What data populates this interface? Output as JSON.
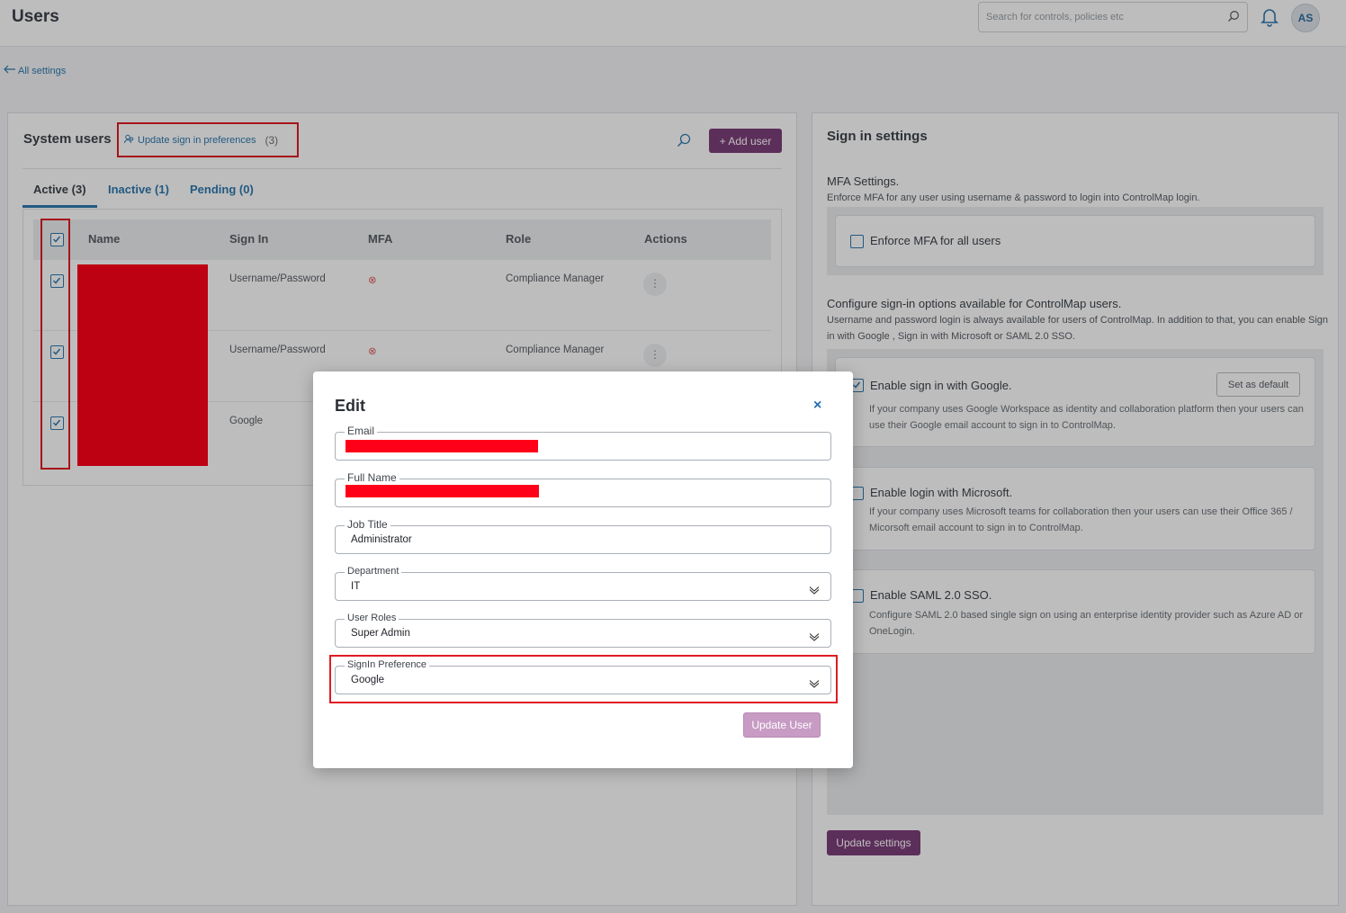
{
  "page": {
    "title": "Users"
  },
  "header": {
    "search_placeholder": "Search for controls, policies etc",
    "avatar_initials": "AS"
  },
  "back_link": "All settings",
  "system_users": {
    "title": "System users",
    "update_prefs_link": "Update sign in preferences",
    "update_prefs_count": "(3)",
    "add_user_label": "+ Add user",
    "tabs": [
      {
        "label": "Active (3)"
      },
      {
        "label": "Inactive (1)"
      },
      {
        "label": "Pending (0)"
      }
    ],
    "columns": [
      "Name",
      "Sign In",
      "MFA",
      "Role",
      "Actions"
    ],
    "rows": [
      {
        "sign_in": "Username/Password",
        "mfa": "⊗",
        "role": "Compliance Manager"
      },
      {
        "sign_in": "Username/Password",
        "mfa": "⊗",
        "role": "Compliance Manager"
      },
      {
        "sign_in": "Google",
        "mfa": "",
        "role": ""
      }
    ]
  },
  "sign_in_settings": {
    "title": "Sign in settings",
    "mfa_heading": "MFA Settings.",
    "mfa_desc": "Enforce MFA for any user using username & password to login into ControlMap login.",
    "mfa_checkbox": "Enforce MFA for all users",
    "configure_heading": "Configure sign-in options available for ControlMap users.",
    "configure_desc": "Username and password login is always available for users of ControlMap. In addition to that, you can enable Sign in with Google , Sign in with Microsoft or SAML 2.0 SSO.",
    "google": {
      "label": "Enable sign in with Google.",
      "desc": "If your company uses Google Workspace as identity and collaboration platform then your users can use their Google email account to sign in to ControlMap.",
      "set_default": "Set as default"
    },
    "microsoft": {
      "label": "Enable login with Microsoft.",
      "desc": "If your company uses Microsoft teams for collaboration then your users can use their Office 365 / Micorsoft email account to sign in to ControlMap."
    },
    "saml": {
      "label": "Enable SAML 2.0 SSO.",
      "desc": "Configure SAML 2.0 based single sign on using an enterprise identity provider such as Azure AD or OneLogin."
    },
    "update_button": "Update settings"
  },
  "modal": {
    "title": "Edit",
    "close": "×",
    "fields": {
      "email": {
        "label": "Email",
        "value": ""
      },
      "full_name": {
        "label": "Full Name",
        "value": ""
      },
      "job_title": {
        "label": "Job Title",
        "value": "Administrator"
      },
      "department": {
        "label": "Department",
        "value": "IT"
      },
      "user_roles": {
        "label": "User Roles",
        "value": "Super Admin"
      },
      "signin_pref": {
        "label": "SignIn Preference",
        "value": "Google"
      }
    },
    "submit": "Update User"
  },
  "colors": {
    "brand": "#7d3f7a",
    "link": "#2f7ab0",
    "highlight": "#e01b24",
    "redaction": "#ff0019"
  }
}
